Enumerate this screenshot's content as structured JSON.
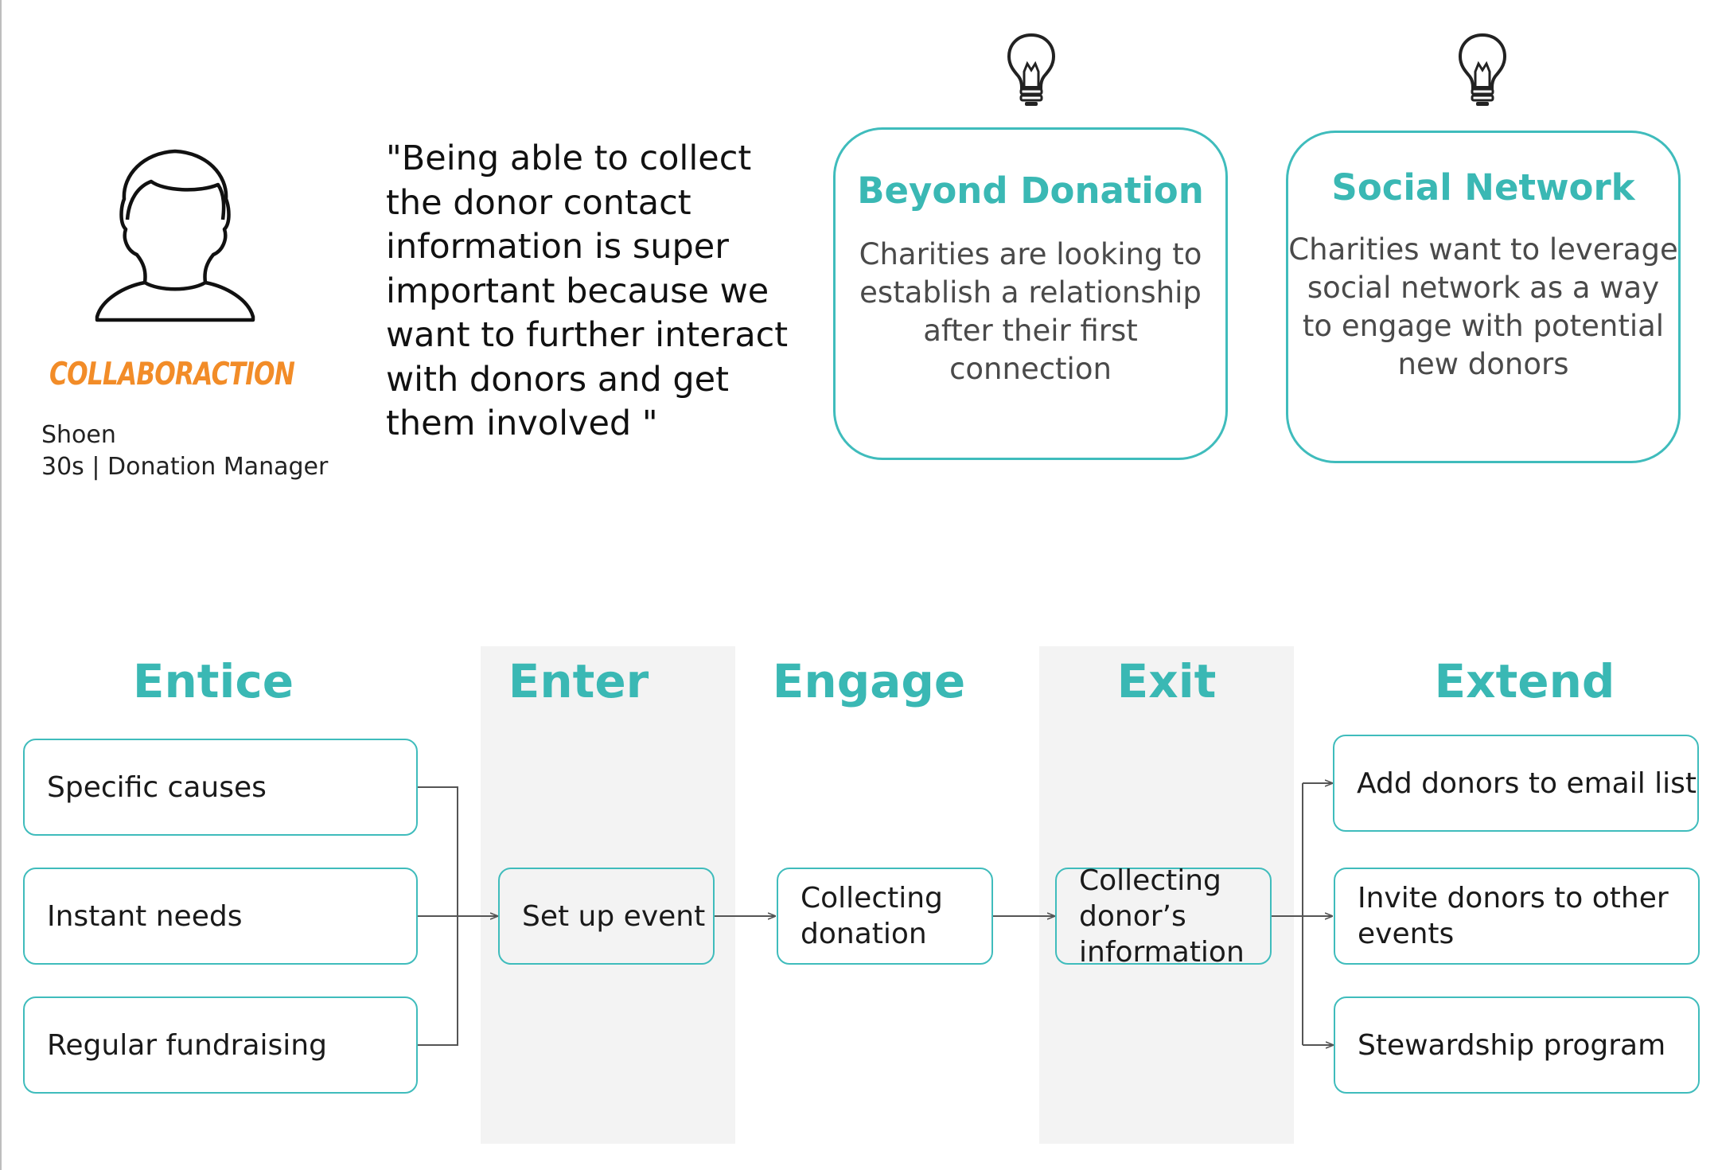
{
  "persona": {
    "icon": "person-silhouette-icon",
    "brand": "COLLABORACTION",
    "name": "Shoen",
    "role": "30s | Donation Manager"
  },
  "quote": {
    "lines": [
      "\"Being able to collect",
      "the donor contact",
      "information is super",
      "important because we",
      "want to further interact",
      "with donors and get",
      "them involved \""
    ]
  },
  "insights": [
    {
      "icon": "lightbulb-icon",
      "title": "Beyond Donation",
      "lines": [
        "Charities are looking to",
        "establish a relationship",
        "after their first",
        "connection"
      ]
    },
    {
      "icon": "lightbulb-icon",
      "title": "Social Network",
      "lines": [
        "Charities want to leverage",
        "social network as a way",
        "to engage with potential",
        "new donors"
      ]
    }
  ],
  "stages": [
    {
      "title": "Entice",
      "shaded": false
    },
    {
      "title": "Enter",
      "shaded": true
    },
    {
      "title": "Engage",
      "shaded": false
    },
    {
      "title": "Exit",
      "shaded": true
    },
    {
      "title": "Extend",
      "shaded": false
    }
  ],
  "steps": {
    "entice": [
      "Specific causes",
      "Instant needs",
      "Regular fundraising"
    ],
    "enter": "Set up event",
    "engage": [
      "Collecting",
      "donation"
    ],
    "exit": [
      "Collecting",
      "donor’s",
      "information"
    ],
    "extend": [
      [
        "Add donors to email list"
      ],
      [
        "Invite donors to other",
        "events"
      ],
      [
        "Stewardship program"
      ]
    ]
  },
  "colors": {
    "accent": "#3ab8b4",
    "border": "#3fbcbc",
    "brand": "#f28c28",
    "band": "#f3f3f3",
    "connector": "#555555"
  }
}
